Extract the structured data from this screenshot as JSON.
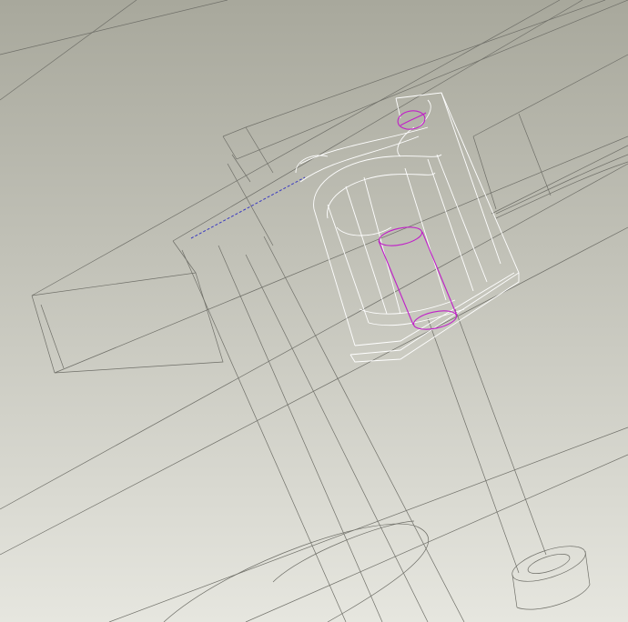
{
  "viewport": {
    "kind": "cad-wireframe-view",
    "colors": {
      "background_top": "#a8a89c",
      "background_bottom": "#e6e6df",
      "hidden_edge": "#6f6f68",
      "selected_edge": "#ffffff",
      "highlight_edge": "#c020c8",
      "axis_line": "#3a3ac0"
    }
  }
}
